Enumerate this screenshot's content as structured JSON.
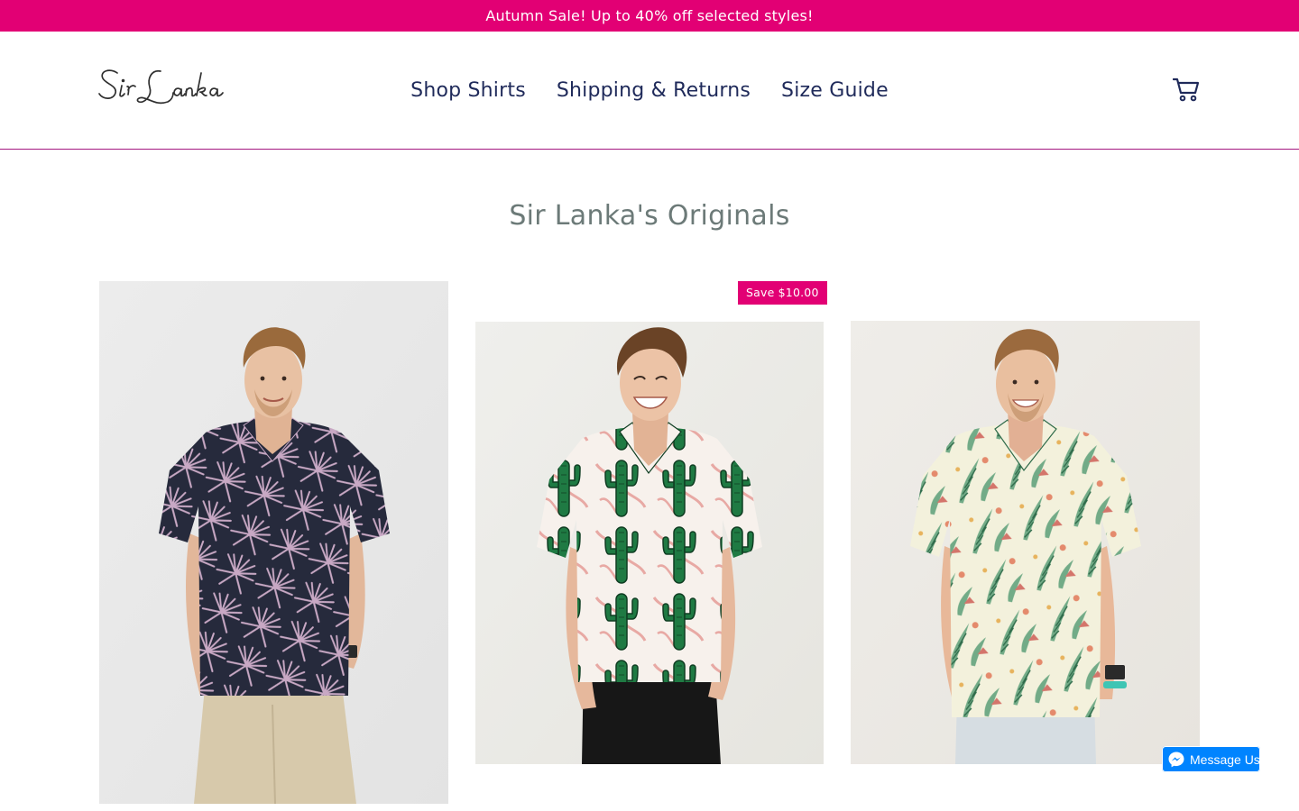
{
  "announcement": {
    "text": "Autumn Sale! Up to 40% off selected styles!"
  },
  "header": {
    "logo_text": "Sir Lanka",
    "nav": [
      {
        "label": "Shop Shirts"
      },
      {
        "label": "Shipping & Returns"
      },
      {
        "label": "Size Guide"
      }
    ],
    "cart_icon": "cart-icon"
  },
  "collection": {
    "title": "Sir Lanka's Originals",
    "products": [
      {
        "image": "man in navy shirt with pink palm-leaf print",
        "badge": ""
      },
      {
        "image": "young man in white shirt with green cactus print",
        "badge": "Save $10.00"
      },
      {
        "image": "man in cream shirt with green tropical leaf print",
        "badge": ""
      }
    ]
  },
  "messenger": {
    "label": "Message Us",
    "icon": "messenger-icon"
  },
  "colors": {
    "accent": "#e20074",
    "nav_text": "#1f2a5a",
    "title_text": "#6c7a78",
    "messenger_blue": "#0084ff"
  }
}
